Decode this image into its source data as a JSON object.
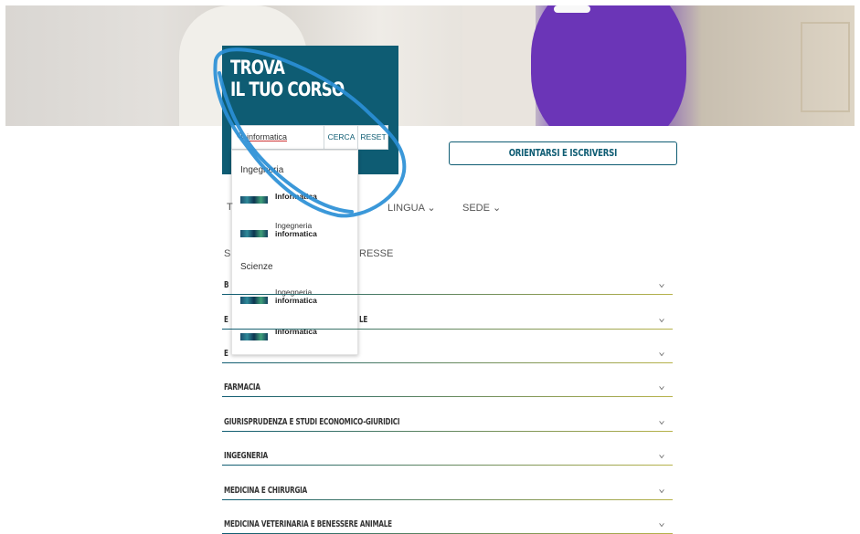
{
  "hero": {
    "accent": "#6b35b7"
  },
  "search_panel": {
    "title_line1": "TROVA",
    "title_line2": "IL TUO CORSO",
    "background": "#0e5c73",
    "search_value": "informatica",
    "search_button": "CERCA",
    "reset_button": "RESET"
  },
  "dropdown": {
    "groups": [
      {
        "name": "Ingegneria",
        "items": [
          {
            "line1": "Informatica",
            "line2": ""
          },
          {
            "line1": "Ingegneria",
            "line2": "informatica"
          }
        ]
      },
      {
        "name": "Scienze",
        "items": [
          {
            "line1": "Ingegneria",
            "line2": "informatica"
          },
          {
            "line1": "Informatica",
            "line2": ""
          }
        ]
      }
    ]
  },
  "orient_button": "ORIENTARSI E ISCRIVERSI",
  "filters": {
    "t_fragment": "T",
    "lingua": "LINGUA ⌄",
    "sede": "SEDE ⌄"
  },
  "fragments": {
    "s_fragment": "S",
    "interesse_fragment": "RESSE",
    "row1_fragment": "B",
    "row2_fragment": "E",
    "row2_tail": "LE",
    "row3_fragment": "E"
  },
  "rows": [
    "",
    "",
    "",
    "FARMACIA",
    "GIURISPRUDENZA E STUDI ECONOMICO-GIURIDICI",
    "INGEGNERIA",
    "MEDICINA E CHIRURGIA",
    "MEDICINA VETERINARIA E BENESSERE ANIMALE"
  ],
  "annotation_color": "#2a8fd6"
}
